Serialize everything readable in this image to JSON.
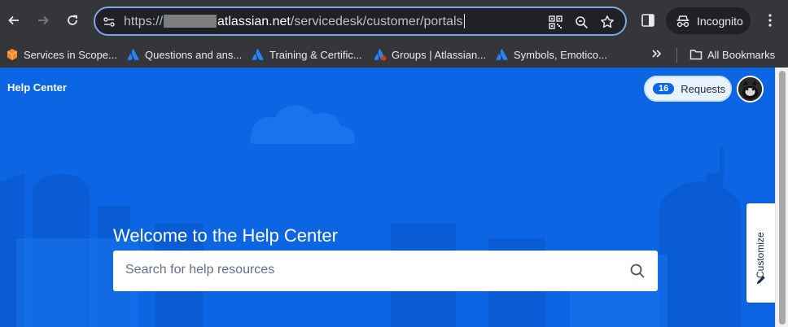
{
  "browser": {
    "url_prefix": "https://",
    "url_domain": "atlassian.net",
    "url_path": "/servicedesk/customer/portals",
    "incognito_label": "Incognito"
  },
  "bookmarks": {
    "items": [
      {
        "label": "Services in Scope...",
        "icon": "orange-cube-icon"
      },
      {
        "label": "Questions and ans...",
        "icon": "atlassian-logo-icon"
      },
      {
        "label": "Training & Certific...",
        "icon": "atlassian-logo-icon"
      },
      {
        "label": "Groups | Atlassian...",
        "icon": "atlassian-logo-icon"
      },
      {
        "label": "Symbols, Emotico...",
        "icon": "atlassian-logo-icon"
      }
    ],
    "all_bookmarks_label": "All Bookmarks"
  },
  "page": {
    "header_title": "Help Center",
    "requests_count": "16",
    "requests_label": "Requests",
    "welcome_title": "Welcome to the Help Center",
    "search_placeholder": "Search for help resources",
    "customize_label": "Customize"
  },
  "colors": {
    "brand_blue": "#0c66e4",
    "chrome_dark": "#35363a",
    "omnibox_focus": "#7ea6e8"
  }
}
